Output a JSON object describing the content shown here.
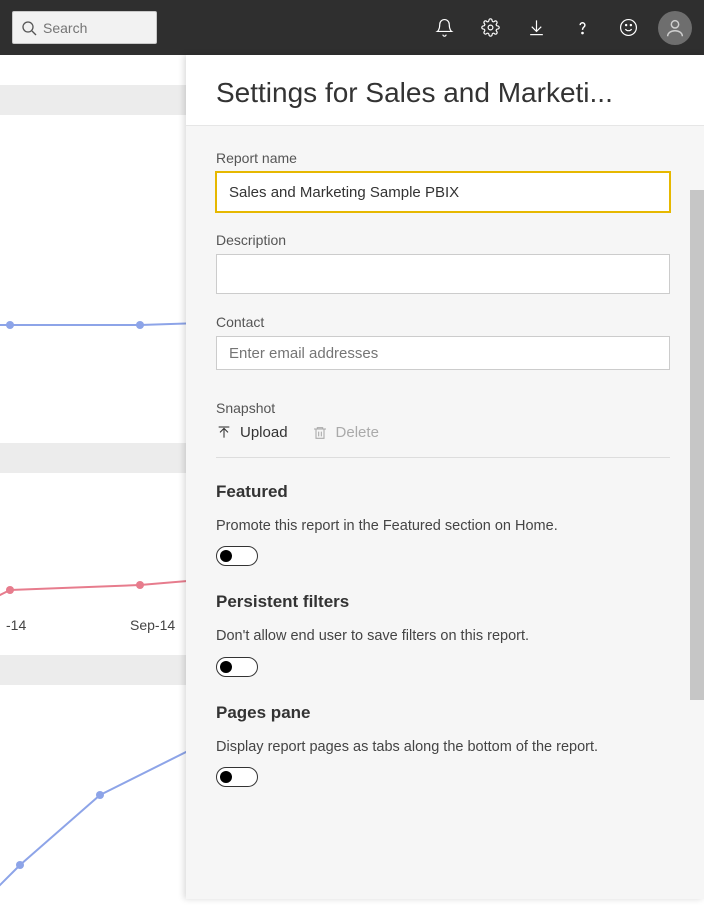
{
  "search": {
    "placeholder": "Search"
  },
  "panel": {
    "title": "Settings for Sales and Marketi...",
    "fields": {
      "report_name_label": "Report name",
      "report_name_value": "Sales and Marketing Sample PBIX",
      "description_label": "Description",
      "description_value": "",
      "contact_label": "Contact",
      "contact_placeholder": "Enter email addresses",
      "snapshot_label": "Snapshot",
      "upload_label": "Upload",
      "delete_label": "Delete"
    },
    "sections": {
      "featured_heading": "Featured",
      "featured_desc": "Promote this report in the Featured section on Home.",
      "persistent_heading": "Persistent filters",
      "persistent_desc": "Don't allow end user to save filters on this report.",
      "pages_heading": "Pages pane",
      "pages_desc": "Display report pages as tabs along the bottom of the report."
    }
  },
  "bg": {
    "axis1": "-14",
    "axis2": "Sep-14"
  },
  "chart_data": [
    {
      "type": "line",
      "series": [
        {
          "name": "blue",
          "color": "#8da4e8"
        }
      ],
      "note": "partial blue line segment visible behind panel"
    },
    {
      "type": "line",
      "categories": [
        "-14",
        "Sep-14"
      ],
      "series": [
        {
          "name": "red",
          "color": "#e77c8d"
        }
      ],
      "note": "partial red line segment visible behind panel with x-axis ticks"
    },
    {
      "type": "line",
      "series": [
        {
          "name": "blue",
          "color": "#8da4e8"
        }
      ],
      "note": "partial ascending blue line segment visible behind panel"
    }
  ]
}
